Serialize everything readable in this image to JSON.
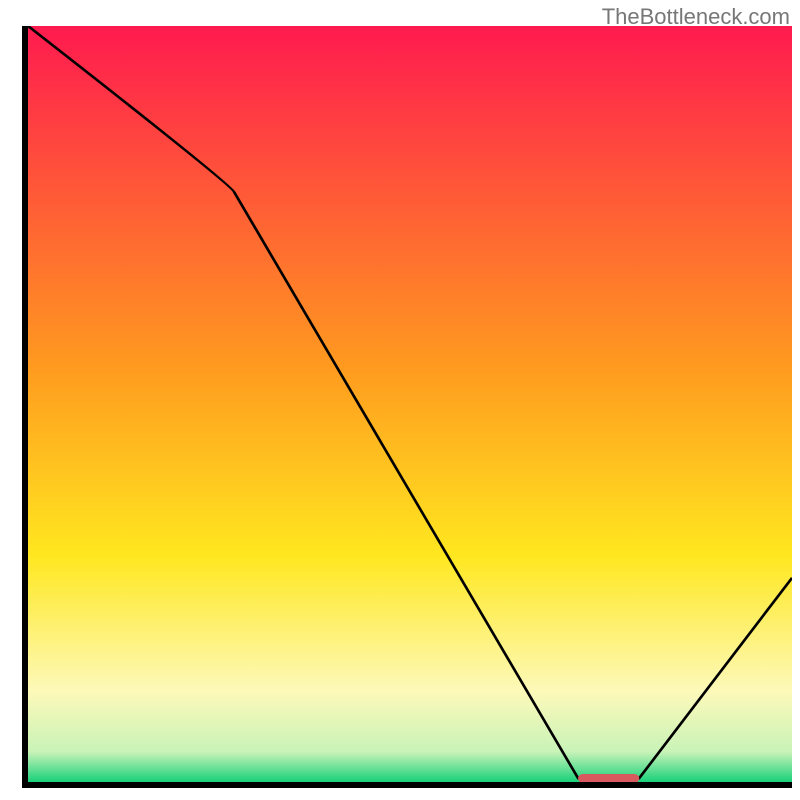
{
  "watermark": "TheBottleneck.com",
  "chart_data": {
    "type": "line",
    "title": "",
    "xlabel": "",
    "ylabel": "",
    "xlim": [
      0,
      100
    ],
    "ylim": [
      0,
      100
    ],
    "x": [
      0,
      27,
      72,
      80,
      100
    ],
    "values": [
      100,
      78,
      0.5,
      0.5,
      27
    ],
    "marker": {
      "x_start": 72,
      "x_end": 80,
      "y": 0.5,
      "color": "#d85a5f"
    },
    "gradient_stops": [
      {
        "pct": 0,
        "color": "#ff1a4f"
      },
      {
        "pct": 45,
        "color": "#ff9a1f"
      },
      {
        "pct": 70,
        "color": "#ffe71f"
      },
      {
        "pct": 88,
        "color": "#fdf9b9"
      },
      {
        "pct": 96,
        "color": "#c9f3b8"
      },
      {
        "pct": 100,
        "color": "#18d17a"
      }
    ]
  }
}
